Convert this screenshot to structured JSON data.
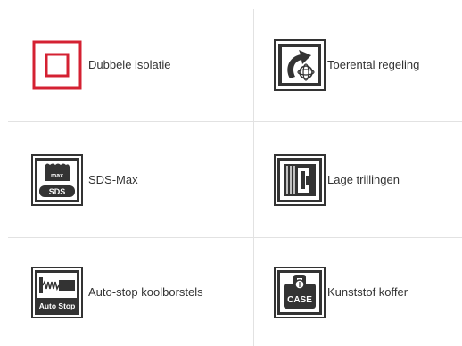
{
  "features": [
    {
      "label": "Dubbele isolatie",
      "icon": "double-insulation-icon",
      "accent": "#d42132"
    },
    {
      "label": "Toerental regeling",
      "icon": "speed-control-icon"
    },
    {
      "label": "SDS-Max",
      "icon": "sds-max-icon",
      "icon_text_top": "max",
      "icon_text_bottom": "SDS"
    },
    {
      "label": "Lage trillingen",
      "icon": "low-vibration-icon"
    },
    {
      "label": "Auto-stop koolborstels",
      "icon": "auto-stop-icon",
      "icon_text": "Auto Stop"
    },
    {
      "label": "Kunststof koffer",
      "icon": "plastic-case-icon",
      "icon_text": "CASE"
    }
  ],
  "colors": {
    "icon_dark": "#333333",
    "divider": "#e2e2e2",
    "text": "#333333"
  }
}
